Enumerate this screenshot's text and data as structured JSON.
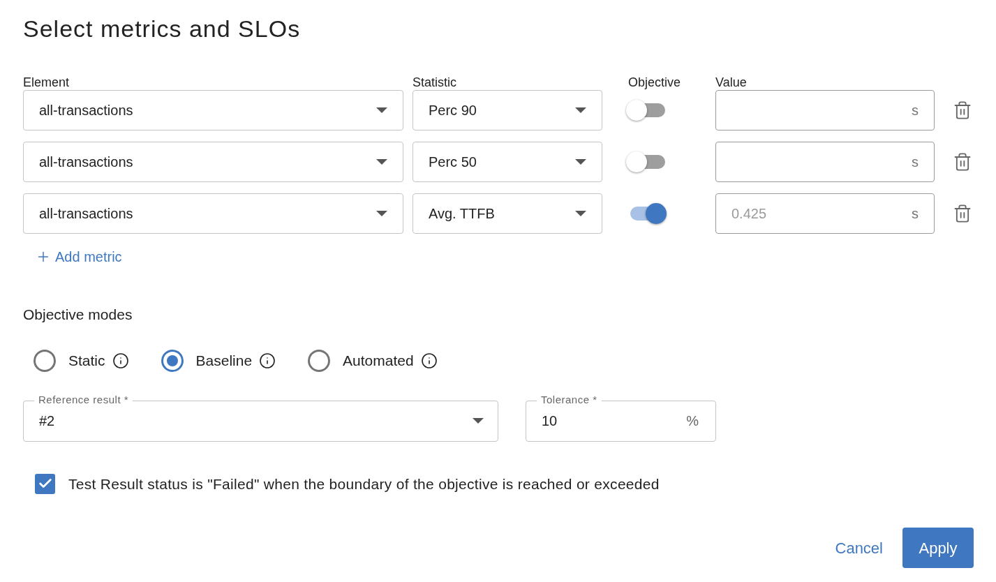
{
  "title": "Select metrics and SLOs",
  "columns": [
    "Element",
    "Statistic",
    "Objective",
    "Value"
  ],
  "metrics": [
    {
      "element": "all-transactions",
      "statistic": "Perc 90",
      "objective": false,
      "unit": "s"
    },
    {
      "element": "all-transactions",
      "statistic": "Perc 50",
      "objective": false,
      "unit": "s"
    },
    {
      "element": "all-transactions",
      "statistic": "Avg. TTFB",
      "objective": true,
      "placeholder": "0.425",
      "unit": "s"
    }
  ],
  "add_metric": "Add metric",
  "objective_modes": {
    "label": "Objective modes",
    "options": [
      {
        "label": "Static",
        "selected": false
      },
      {
        "label": "Baseline",
        "selected": true
      },
      {
        "label": "Automated",
        "selected": false
      }
    ]
  },
  "reference_result": {
    "label": "Reference result *",
    "value": "#2"
  },
  "tolerance": {
    "label": "Tolerance *",
    "value": "10",
    "unit": "%"
  },
  "fail_checkbox": {
    "label": "Test Result status is \"Failed\" when the boundary of the objective is reached or exceeded",
    "checked": true
  },
  "buttons": {
    "cancel": "Cancel",
    "apply": "Apply"
  }
}
